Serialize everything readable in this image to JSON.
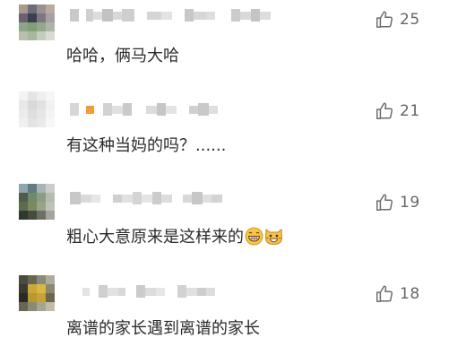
{
  "comments": [
    {
      "text": "哈哈，俩马大哈",
      "likes": "25",
      "avatar_colors": [
        "#a99a8c",
        "#6d6d7a",
        "#9a8f91",
        "#b7aba0",
        "#6b6170",
        "#3b3f52",
        "#7d7880",
        "#a6a0a0",
        "#8fa389",
        "#7f9f7a",
        "#93a78a",
        "#aeb5a8",
        "#b6c0ad",
        "#a8b89e",
        "#c4ccbd",
        "#d6dbd3"
      ],
      "emojis": []
    },
    {
      "text": "有这种当妈的吗？......",
      "likes": "21",
      "avatar_colors": [
        "#f3f3f3",
        "#e5e5e5",
        "#efefef",
        "#f6f6f6",
        "#e8e8e8",
        "#d9d9d9",
        "#e1e1e1",
        "#f1f1f1",
        "#ececec",
        "#dedede",
        "#e6e6e6",
        "#f4f4f4",
        "#f0f0f0",
        "#e3e3e3",
        "#e9e9e9",
        "#f7f7f7"
      ],
      "accent": "#f59a3a",
      "emojis": []
    },
    {
      "text": "粗心大意原来是这样来的",
      "likes": "19",
      "avatar_colors": [
        "#8fa6b0",
        "#5f7c85",
        "#a8b4b3",
        "#c8cdc9",
        "#4d5c4c",
        "#6f8a6a",
        "#8e9c86",
        "#b3bcb0",
        "#5d6b4f",
        "#7b8a5d",
        "#9aa287",
        "#bfc3b8",
        "#2f3a2c",
        "#454d3f",
        "#6c7065",
        "#a2a59e"
      ],
      "emojis": [
        "grin-emoji",
        "cat-grin-emoji"
      ]
    },
    {
      "text": "离谱的家长遇到离谱的家长",
      "likes": "18",
      "avatar_colors": [
        "#4a4a40",
        "#6a6450",
        "#8a8a78",
        "#b0ab98",
        "#3a3a30",
        "#c8a838",
        "#d8b840",
        "#8c8870",
        "#2a2a22",
        "#b89830",
        "#c4a438",
        "#6a6650",
        "#6a6654",
        "#8c8a74",
        "#a8a490",
        "#c0bca8"
      ],
      "emojis": []
    }
  ],
  "icons": {
    "like": "thumbs-up-icon"
  },
  "colors": {
    "like_icon": "#6b6b6b",
    "text": "#2b2b2b",
    "count": "#666666"
  }
}
